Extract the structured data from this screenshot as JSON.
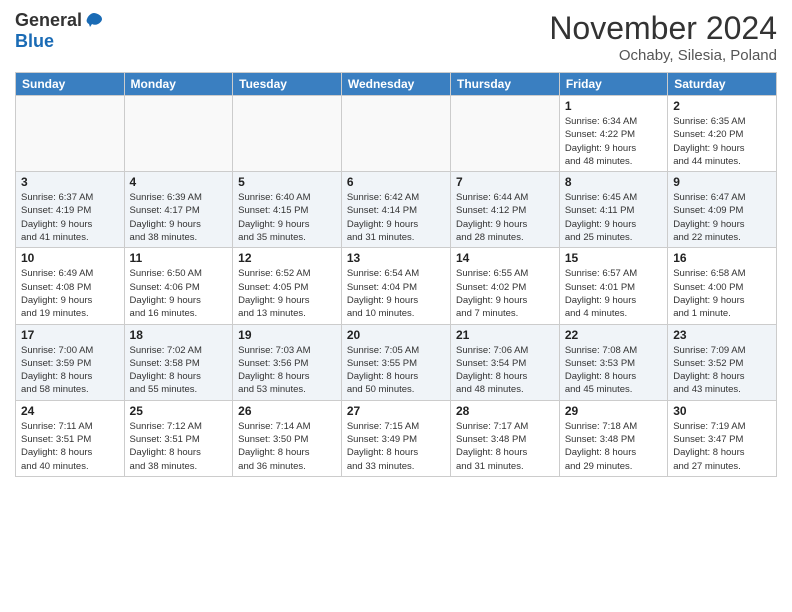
{
  "header": {
    "logo_general": "General",
    "logo_blue": "Blue",
    "month_title": "November 2024",
    "location": "Ochaby, Silesia, Poland"
  },
  "days_of_week": [
    "Sunday",
    "Monday",
    "Tuesday",
    "Wednesday",
    "Thursday",
    "Friday",
    "Saturday"
  ],
  "weeks": [
    [
      {
        "day": "",
        "info": "",
        "empty": true
      },
      {
        "day": "",
        "info": "",
        "empty": true
      },
      {
        "day": "",
        "info": "",
        "empty": true
      },
      {
        "day": "",
        "info": "",
        "empty": true
      },
      {
        "day": "",
        "info": "",
        "empty": true
      },
      {
        "day": "1",
        "info": "Sunrise: 6:34 AM\nSunset: 4:22 PM\nDaylight: 9 hours\nand 48 minutes.",
        "empty": false
      },
      {
        "day": "2",
        "info": "Sunrise: 6:35 AM\nSunset: 4:20 PM\nDaylight: 9 hours\nand 44 minutes.",
        "empty": false
      }
    ],
    [
      {
        "day": "3",
        "info": "Sunrise: 6:37 AM\nSunset: 4:19 PM\nDaylight: 9 hours\nand 41 minutes.",
        "empty": false
      },
      {
        "day": "4",
        "info": "Sunrise: 6:39 AM\nSunset: 4:17 PM\nDaylight: 9 hours\nand 38 minutes.",
        "empty": false
      },
      {
        "day": "5",
        "info": "Sunrise: 6:40 AM\nSunset: 4:15 PM\nDaylight: 9 hours\nand 35 minutes.",
        "empty": false
      },
      {
        "day": "6",
        "info": "Sunrise: 6:42 AM\nSunset: 4:14 PM\nDaylight: 9 hours\nand 31 minutes.",
        "empty": false
      },
      {
        "day": "7",
        "info": "Sunrise: 6:44 AM\nSunset: 4:12 PM\nDaylight: 9 hours\nand 28 minutes.",
        "empty": false
      },
      {
        "day": "8",
        "info": "Sunrise: 6:45 AM\nSunset: 4:11 PM\nDaylight: 9 hours\nand 25 minutes.",
        "empty": false
      },
      {
        "day": "9",
        "info": "Sunrise: 6:47 AM\nSunset: 4:09 PM\nDaylight: 9 hours\nand 22 minutes.",
        "empty": false
      }
    ],
    [
      {
        "day": "10",
        "info": "Sunrise: 6:49 AM\nSunset: 4:08 PM\nDaylight: 9 hours\nand 19 minutes.",
        "empty": false
      },
      {
        "day": "11",
        "info": "Sunrise: 6:50 AM\nSunset: 4:06 PM\nDaylight: 9 hours\nand 16 minutes.",
        "empty": false
      },
      {
        "day": "12",
        "info": "Sunrise: 6:52 AM\nSunset: 4:05 PM\nDaylight: 9 hours\nand 13 minutes.",
        "empty": false
      },
      {
        "day": "13",
        "info": "Sunrise: 6:54 AM\nSunset: 4:04 PM\nDaylight: 9 hours\nand 10 minutes.",
        "empty": false
      },
      {
        "day": "14",
        "info": "Sunrise: 6:55 AM\nSunset: 4:02 PM\nDaylight: 9 hours\nand 7 minutes.",
        "empty": false
      },
      {
        "day": "15",
        "info": "Sunrise: 6:57 AM\nSunset: 4:01 PM\nDaylight: 9 hours\nand 4 minutes.",
        "empty": false
      },
      {
        "day": "16",
        "info": "Sunrise: 6:58 AM\nSunset: 4:00 PM\nDaylight: 9 hours\nand 1 minute.",
        "empty": false
      }
    ],
    [
      {
        "day": "17",
        "info": "Sunrise: 7:00 AM\nSunset: 3:59 PM\nDaylight: 8 hours\nand 58 minutes.",
        "empty": false
      },
      {
        "day": "18",
        "info": "Sunrise: 7:02 AM\nSunset: 3:58 PM\nDaylight: 8 hours\nand 55 minutes.",
        "empty": false
      },
      {
        "day": "19",
        "info": "Sunrise: 7:03 AM\nSunset: 3:56 PM\nDaylight: 8 hours\nand 53 minutes.",
        "empty": false
      },
      {
        "day": "20",
        "info": "Sunrise: 7:05 AM\nSunset: 3:55 PM\nDaylight: 8 hours\nand 50 minutes.",
        "empty": false
      },
      {
        "day": "21",
        "info": "Sunrise: 7:06 AM\nSunset: 3:54 PM\nDaylight: 8 hours\nand 48 minutes.",
        "empty": false
      },
      {
        "day": "22",
        "info": "Sunrise: 7:08 AM\nSunset: 3:53 PM\nDaylight: 8 hours\nand 45 minutes.",
        "empty": false
      },
      {
        "day": "23",
        "info": "Sunrise: 7:09 AM\nSunset: 3:52 PM\nDaylight: 8 hours\nand 43 minutes.",
        "empty": false
      }
    ],
    [
      {
        "day": "24",
        "info": "Sunrise: 7:11 AM\nSunset: 3:51 PM\nDaylight: 8 hours\nand 40 minutes.",
        "empty": false
      },
      {
        "day": "25",
        "info": "Sunrise: 7:12 AM\nSunset: 3:51 PM\nDaylight: 8 hours\nand 38 minutes.",
        "empty": false
      },
      {
        "day": "26",
        "info": "Sunrise: 7:14 AM\nSunset: 3:50 PM\nDaylight: 8 hours\nand 36 minutes.",
        "empty": false
      },
      {
        "day": "27",
        "info": "Sunrise: 7:15 AM\nSunset: 3:49 PM\nDaylight: 8 hours\nand 33 minutes.",
        "empty": false
      },
      {
        "day": "28",
        "info": "Sunrise: 7:17 AM\nSunset: 3:48 PM\nDaylight: 8 hours\nand 31 minutes.",
        "empty": false
      },
      {
        "day": "29",
        "info": "Sunrise: 7:18 AM\nSunset: 3:48 PM\nDaylight: 8 hours\nand 29 minutes.",
        "empty": false
      },
      {
        "day": "30",
        "info": "Sunrise: 7:19 AM\nSunset: 3:47 PM\nDaylight: 8 hours\nand 27 minutes.",
        "empty": false
      }
    ]
  ]
}
